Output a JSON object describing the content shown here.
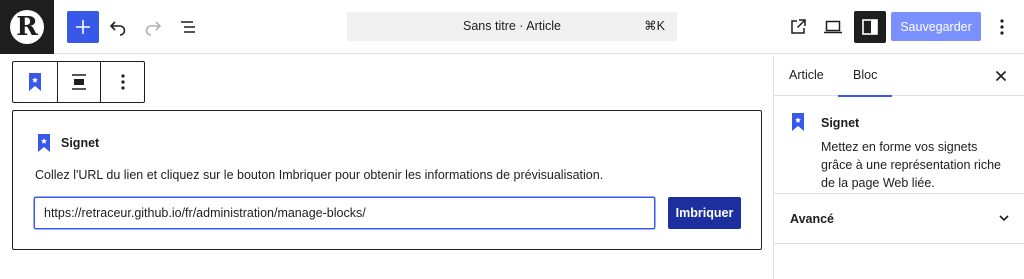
{
  "logo": {
    "letter": "R"
  },
  "toolbar": {
    "add_icon": "plus-icon",
    "undo_icon": "undo-icon",
    "redo_icon": "redo-icon",
    "outline_icon": "list-view-icon",
    "document_title": "Sans titre · Article",
    "shortcut": "⌘K",
    "view_icon": "external-link-icon",
    "preview_icon": "desktop-icon",
    "settings_icon": "sidebar-icon",
    "save_label": "Sauvegarder",
    "more_icon": "more-vertical-icon"
  },
  "block_toolbar": {
    "type_icon": "bookmark-icon",
    "align_icon": "align-center-icon",
    "more_icon": "more-vertical-icon"
  },
  "placeholder": {
    "title": "Signet",
    "instructions": "Collez l'URL du lien et cliquez sur le bouton Imbriquer pour obtenir les informations de prévisualisation.",
    "url_value": "https://retraceur.github.io/fr/administration/manage-blocks/",
    "embed_label": "Imbriquer"
  },
  "sidebar": {
    "tabs": [
      {
        "label": "Article",
        "active": false
      },
      {
        "label": "Bloc",
        "active": true
      }
    ],
    "block": {
      "title": "Signet",
      "description": "Mettez en forme vos signets grâce à une représentation riche de la page Web liée."
    },
    "advanced_label": "Avancé"
  },
  "colors": {
    "accent": "#3858e9",
    "save_button": "#7b90ff",
    "embed_button": "#1d2f9e",
    "dark": "#1e1e1e"
  }
}
